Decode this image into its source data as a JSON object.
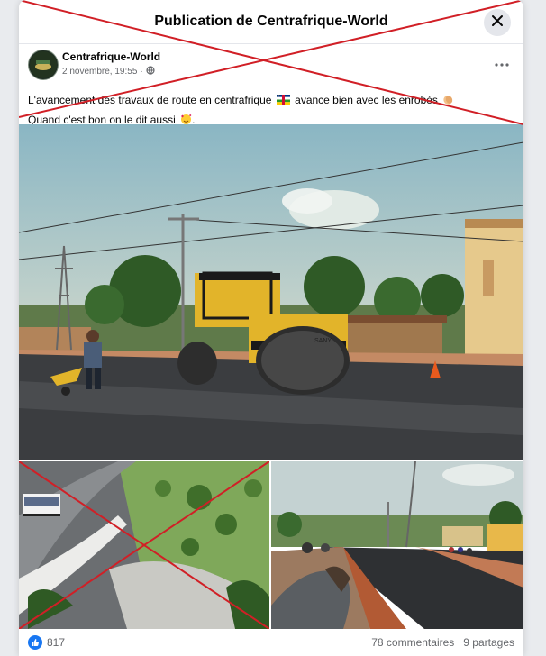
{
  "modal": {
    "title": "Publication de Centrafrique-World"
  },
  "post": {
    "page_name": "Centrafrique-World",
    "date": "2 novembre, 19:55",
    "separator": "·",
    "text_line1_a": "L'avancement des travaux de route en centrafrique",
    "text_line1_b": "avance bien avec les enrobés",
    "text_line2": "Quand c'est bon on le dit aussi",
    "icons": {
      "close": "close-icon",
      "more": "more-options-icon",
      "privacy": "globe-icon",
      "flag": "central-african-flag-emoji",
      "clap": "clapping-hands-emoji",
      "love": "smiling-face-with-hearts-emoji"
    }
  },
  "photos": {
    "main": "road-roller-on-new-asphalt-photo",
    "bottom_left": "highway-interchange-photo-crossed-out",
    "bottom_right": "new-asphalt-road-street-photo"
  },
  "stats": {
    "reactions": "817",
    "comments": "78 commentaires",
    "shares": "9 partages"
  },
  "colors": {
    "accent": "#1877f2",
    "cross": "#d11f26"
  }
}
